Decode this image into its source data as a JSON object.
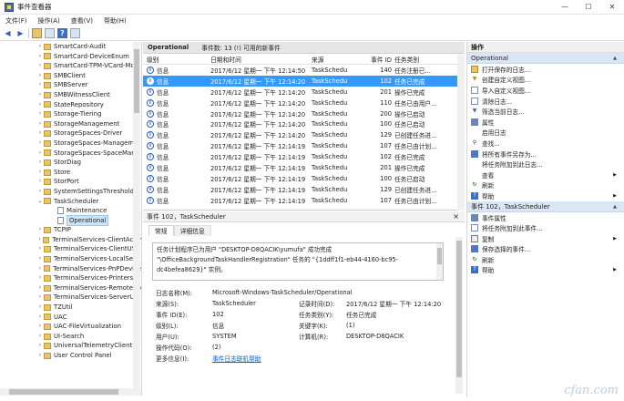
{
  "window": {
    "title": "事件查看器",
    "controls": [
      "—",
      "☐",
      "✕"
    ]
  },
  "menu": [
    "文件(F)",
    "操作(A)",
    "查看(V)",
    "帮助(H)"
  ],
  "tree": {
    "items": [
      {
        "label": "SmartCard-Audit",
        "type": "folder"
      },
      {
        "label": "SmartCard-DeviceEnum",
        "type": "folder"
      },
      {
        "label": "SmartCard-TPM-VCard-Mo",
        "type": "folder"
      },
      {
        "label": "SMBClient",
        "type": "folder"
      },
      {
        "label": "SMBServer",
        "type": "folder"
      },
      {
        "label": "SMBWitnessClient",
        "type": "folder"
      },
      {
        "label": "StateRepository",
        "type": "folder"
      },
      {
        "label": "Storage-Tiering",
        "type": "folder"
      },
      {
        "label": "StorageManagement",
        "type": "folder"
      },
      {
        "label": "StorageSpaces-Driver",
        "type": "folder"
      },
      {
        "label": "StorageSpaces-Manageme",
        "type": "folder"
      },
      {
        "label": "StorageSpaces-SpaceMana",
        "type": "folder"
      },
      {
        "label": "StorDiag",
        "type": "folder"
      },
      {
        "label": "Store",
        "type": "folder"
      },
      {
        "label": "StorPort",
        "type": "folder"
      },
      {
        "label": "SystemSettingsThreshold",
        "type": "folder"
      },
      {
        "label": "TaskScheduler",
        "type": "folder-open"
      },
      {
        "label": "Maintenance",
        "type": "log"
      },
      {
        "label": "Operational",
        "type": "log-selected"
      },
      {
        "label": "TCPIP",
        "type": "folder"
      },
      {
        "label": "TerminalServices-ClientActiv",
        "type": "folder"
      },
      {
        "label": "TerminalServices-ClientUSB",
        "type": "folder"
      },
      {
        "label": "TerminalServices-LocalSess",
        "type": "folder"
      },
      {
        "label": "TerminalServices-PnPDevice",
        "type": "folder"
      },
      {
        "label": "TerminalServices-Printers",
        "type": "folder"
      },
      {
        "label": "TerminalServices-RemoteCo",
        "type": "folder"
      },
      {
        "label": "TerminalServices-ServerUSI",
        "type": "folder"
      },
      {
        "label": "TZUtil",
        "type": "folder"
      },
      {
        "label": "UAC",
        "type": "folder"
      },
      {
        "label": "UAC-FileVirtualization",
        "type": "folder"
      },
      {
        "label": "UI-Search",
        "type": "folder"
      },
      {
        "label": "UniversalTelemetryClient",
        "type": "folder"
      },
      {
        "label": "User Control Panel",
        "type": "folder"
      }
    ]
  },
  "events_pane": {
    "title": "Operational",
    "count_text": "事件数: 13 (!) 可用的新事件",
    "columns": [
      "级别",
      "日期和时间",
      "来源",
      "事件 ID",
      "任务类别"
    ],
    "rows": [
      {
        "level": "信息",
        "datetime": "2017/6/12 星期一 下午 12:14:50",
        "source": "TaskSchedu",
        "id": "140",
        "category": "任务注册已..."
      },
      {
        "level": "信息",
        "datetime": "2017/6/12 星期一 下午 12:14:20",
        "source": "TaskSchedu",
        "id": "102",
        "category": "任务已完成"
      },
      {
        "level": "信息",
        "datetime": "2017/6/12 星期一 下午 12:14:20",
        "source": "TaskSchedu",
        "id": "201",
        "category": "操作已完成"
      },
      {
        "level": "信息",
        "datetime": "2017/6/12 星期一 下午 12:14:20",
        "source": "TaskSchedu",
        "id": "110",
        "category": "任务已由用户..."
      },
      {
        "level": "信息",
        "datetime": "2017/6/12 星期一 下午 12:14:20",
        "source": "TaskSchedu",
        "id": "200",
        "category": "操作已启动"
      },
      {
        "level": "信息",
        "datetime": "2017/6/12 星期一 下午 12:14:20",
        "source": "TaskSchedu",
        "id": "100",
        "category": "任务已启动"
      },
      {
        "level": "信息",
        "datetime": "2017/6/12 星期一 下午 12:14:20",
        "source": "TaskSchedu",
        "id": "129",
        "category": "已创建任务进..."
      },
      {
        "level": "信息",
        "datetime": "2017/6/12 星期一 下午 12:14:19",
        "source": "TaskSchedu",
        "id": "107",
        "category": "任务已由计划..."
      },
      {
        "level": "信息",
        "datetime": "2017/6/12 星期一 下午 12:14:19",
        "source": "TaskSchedu",
        "id": "102",
        "category": "任务已完成"
      },
      {
        "level": "信息",
        "datetime": "2017/6/12 星期一 下午 12:14:19",
        "source": "TaskSchedu",
        "id": "201",
        "category": "操作已完成"
      },
      {
        "level": "信息",
        "datetime": "2017/6/12 星期一 下午 12:14:19",
        "source": "TaskSchedu",
        "id": "100",
        "category": "任务已启动"
      },
      {
        "level": "信息",
        "datetime": "2017/6/12 星期一 下午 12:14:19",
        "source": "TaskSchedu",
        "id": "129",
        "category": "已创建任务进..."
      },
      {
        "level": "信息",
        "datetime": "2017/6/12 星期一 下午 12:14:19",
        "source": "TaskSchedu",
        "id": "107",
        "category": "任务已由计划..."
      }
    ]
  },
  "detail": {
    "header": "事件 102，TaskScheduler",
    "close": "×",
    "tabs": [
      "常规",
      "详细信息"
    ],
    "description": [
      "任务计划程序已为用户 \"DESKTOP-D8QACIK\\yumufa\" 成功完成",
      "\"\\OfficeBackgroundTaskHandlerRegistration\" 任务的 \"{1ddff1f1-eb44-4160-bc95-",
      "dc4befea8629}\" 实例。"
    ],
    "props": {
      "logname_label": "日志名称(M):",
      "logname": "Microsoft-Windows-TaskScheduler/Operational",
      "source_label": "来源(S):",
      "source": "TaskScheduler",
      "logged_label": "记录时间(D):",
      "logged": "2017/6/12 星期一 下午 12:14:20",
      "eventid_label": "事件 ID(E):",
      "eventid": "102",
      "taskcat_label": "任务类别(Y):",
      "taskcat": "任务已完成",
      "level_label": "级别(L):",
      "level": "信息",
      "keywords_label": "关键字(K):",
      "keywords": "(1)",
      "user_label": "用户(U):",
      "user": "SYSTEM",
      "computer_label": "计算机(R):",
      "computer": "DESKTOP-D8QACIK",
      "opcode_label": "操作代码(O):",
      "opcode": "(2)",
      "more_label": "更多信息(I):",
      "more": "事件日志联机帮助"
    }
  },
  "actions": {
    "header": "操作",
    "section1": "Operational",
    "items1": [
      {
        "label": "打开保存的日志...",
        "icon": "open",
        "glyph": ""
      },
      {
        "label": "创建自定义视图...",
        "icon": "filter",
        "glyph": "▼"
      },
      {
        "label": "导入自定义视图...",
        "icon": "doc",
        "glyph": ""
      },
      {
        "label": "清除日志...",
        "icon": "doc",
        "glyph": ""
      },
      {
        "label": "筛选当前日志...",
        "icon": "funnel",
        "glyph": "▼"
      },
      {
        "label": "属性",
        "icon": "props",
        "glyph": ""
      },
      {
        "label": "启用日志",
        "icon": "none",
        "glyph": ""
      },
      {
        "label": "查找...",
        "icon": "find",
        "glyph": "⚲"
      },
      {
        "label": "将所有事件另存为...",
        "icon": "save",
        "glyph": ""
      },
      {
        "label": "将任务附加到此日志...",
        "icon": "none",
        "glyph": ""
      },
      {
        "label": "查看",
        "icon": "none",
        "glyph": "",
        "submenu": true
      },
      {
        "label": "刷新",
        "icon": "refresh",
        "glyph": "↻"
      },
      {
        "label": "帮助",
        "icon": "help",
        "glyph": "?",
        "submenu": true
      }
    ],
    "section2": "事件 102，TaskScheduler",
    "items2": [
      {
        "label": "事件属性",
        "icon": "props",
        "glyph": ""
      },
      {
        "label": "将任务附加到此事件...",
        "icon": "doc",
        "glyph": ""
      },
      {
        "label": "复制",
        "icon": "copy",
        "glyph": "",
        "submenu": true
      },
      {
        "label": "保存选择的事件...",
        "icon": "save",
        "glyph": ""
      },
      {
        "label": "刷新",
        "icon": "refresh",
        "glyph": "↻"
      },
      {
        "label": "帮助",
        "icon": "help",
        "glyph": "?",
        "submenu": true
      }
    ]
  },
  "watermark": "cfan.com"
}
